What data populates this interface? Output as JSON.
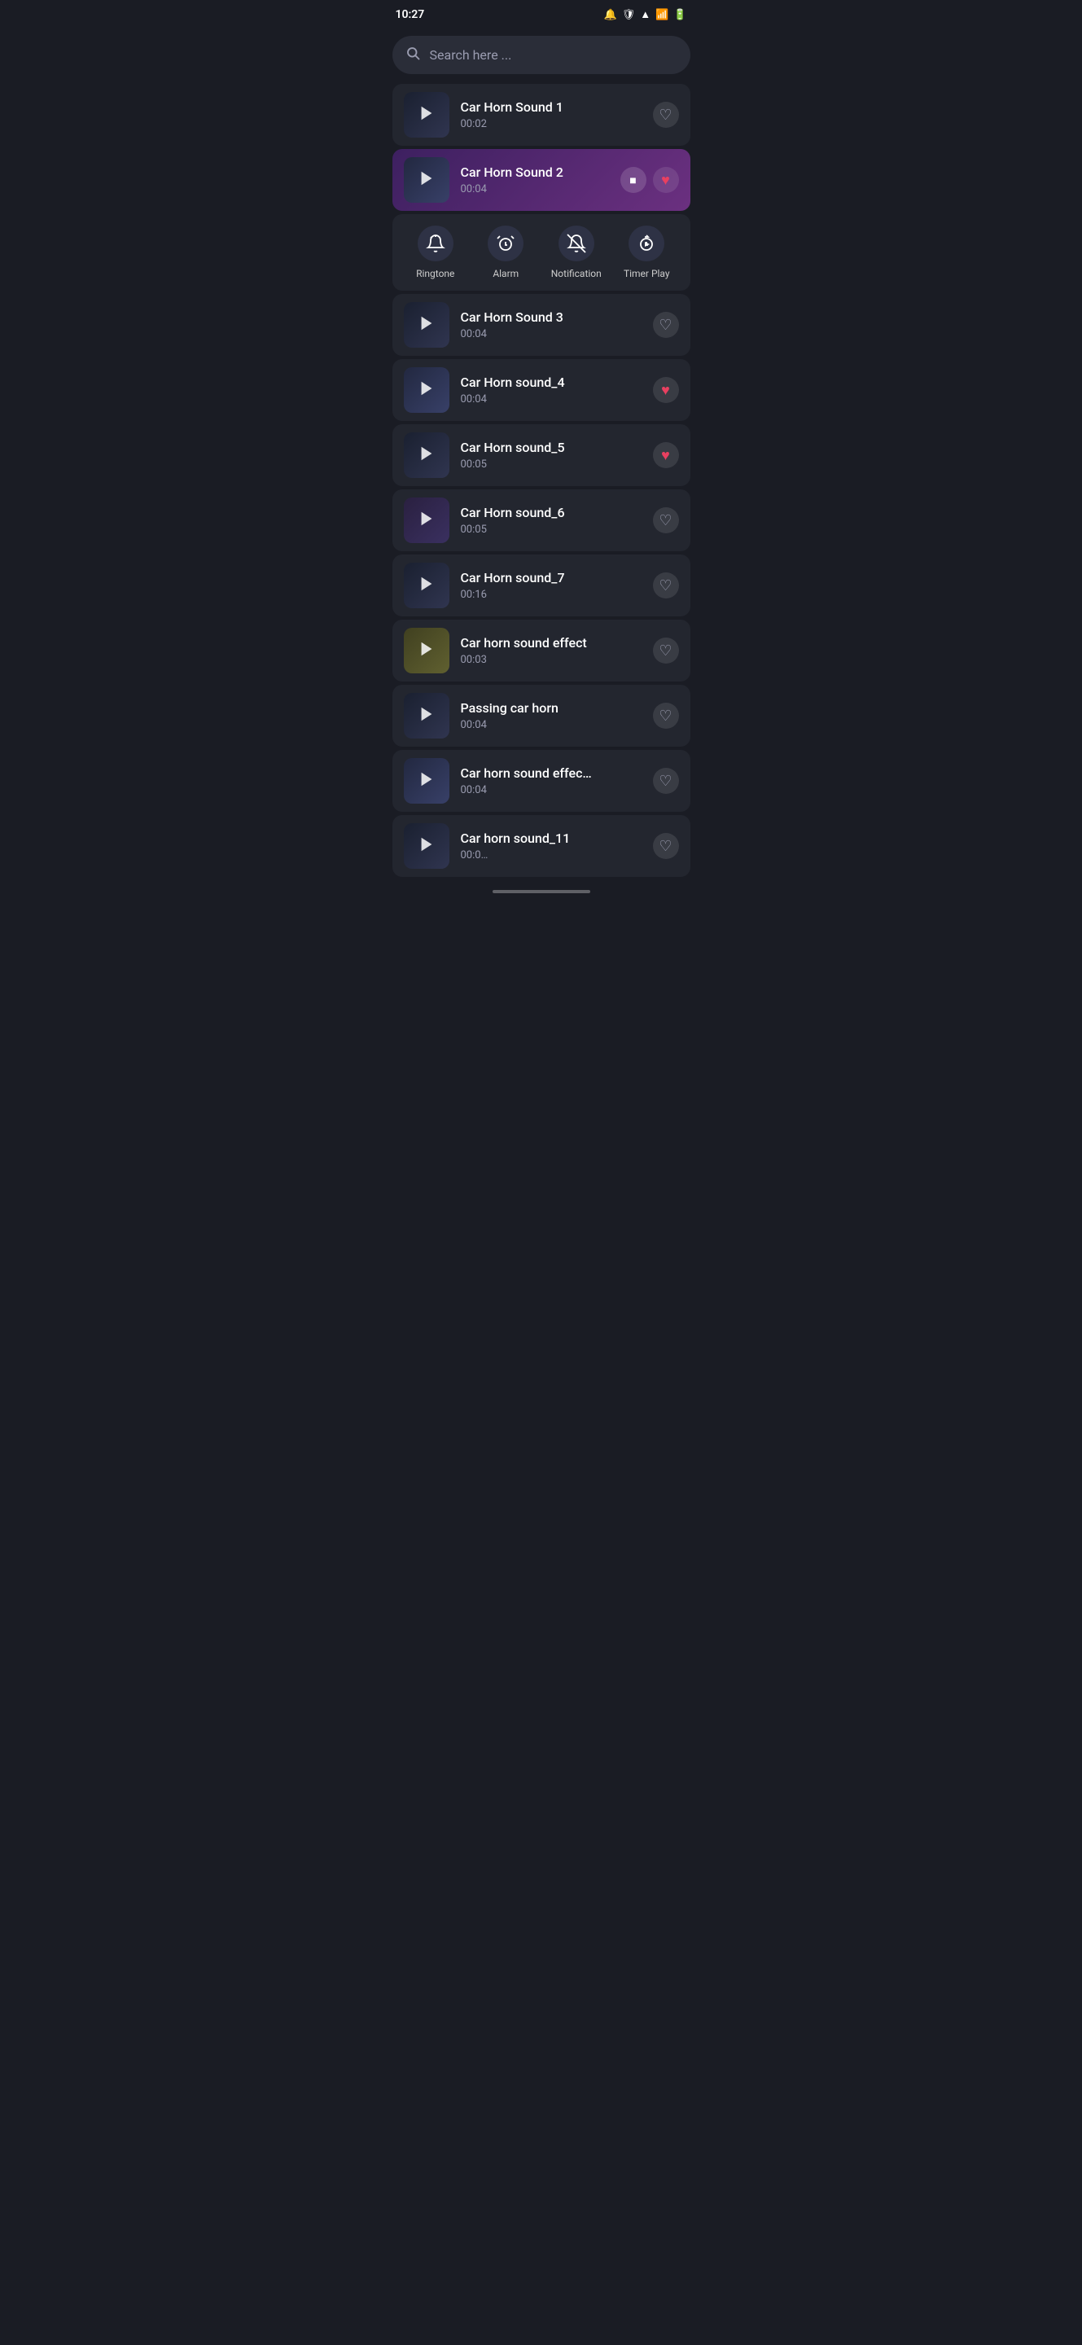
{
  "statusBar": {
    "time": "10:27",
    "icons": [
      "signal",
      "wifi-shield",
      "wifi",
      "cellular",
      "battery"
    ]
  },
  "search": {
    "placeholder": "Search here ..."
  },
  "sounds": [
    {
      "id": "car-horn-1",
      "title": "Car Horn Sound 1",
      "duration": "00:02",
      "favorited": false,
      "active": false,
      "thumbnailClass": "car1"
    },
    {
      "id": "car-horn-2",
      "title": "Car Horn Sound 2",
      "duration": "00:04",
      "favorited": true,
      "active": true,
      "thumbnailClass": "car2"
    },
    {
      "id": "car-horn-3",
      "title": "Car Horn Sound 3",
      "duration": "00:04",
      "favorited": false,
      "active": false,
      "thumbnailClass": "car1"
    },
    {
      "id": "car-horn-4",
      "title": "Car Horn sound_4",
      "duration": "00:04",
      "favorited": true,
      "active": false,
      "thumbnailClass": "car2"
    },
    {
      "id": "car-horn-5",
      "title": "Car Horn sound_5",
      "duration": "00:05",
      "favorited": true,
      "active": false,
      "thumbnailClass": "car1"
    },
    {
      "id": "car-horn-6",
      "title": "Car Horn sound_6",
      "duration": "00:05",
      "favorited": false,
      "active": false,
      "thumbnailClass": "car6"
    },
    {
      "id": "car-horn-7",
      "title": "Car Horn sound_7",
      "duration": "00:16",
      "favorited": false,
      "active": false,
      "thumbnailClass": "car1"
    },
    {
      "id": "car-horn-effect",
      "title": "Car horn sound effect",
      "duration": "00:03",
      "favorited": false,
      "active": false,
      "thumbnailClass": "careffect"
    },
    {
      "id": "passing-car-horn",
      "title": "Passing car horn",
      "duration": "00:04",
      "favorited": false,
      "active": false,
      "thumbnailClass": "car1"
    },
    {
      "id": "car-horn-effect-2",
      "title": "Car horn sound effec…",
      "duration": "00:04",
      "favorited": false,
      "active": false,
      "thumbnailClass": "car2"
    },
    {
      "id": "car-horn-11",
      "title": "Car horn sound_11",
      "duration": "00:0…",
      "favorited": false,
      "active": false,
      "thumbnailClass": "car1"
    }
  ],
  "actionMenu": {
    "items": [
      {
        "id": "ringtone",
        "label": "Ringtone",
        "icon": "🔔"
      },
      {
        "id": "alarm",
        "label": "Alarm",
        "icon": "⏰"
      },
      {
        "id": "notification",
        "label": "Notification",
        "icon": "🔕"
      },
      {
        "id": "timer-play",
        "label": "Timer Play",
        "icon": "⏱"
      }
    ]
  }
}
